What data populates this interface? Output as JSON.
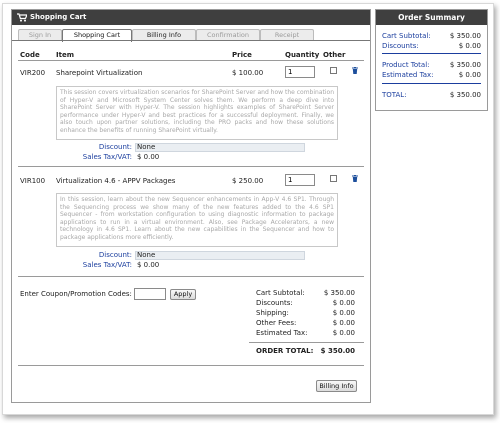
{
  "cart": {
    "title": "Shopping Cart",
    "tabs": [
      "Sign In",
      "Shopping Cart",
      "Billing Info",
      "Confirmation",
      "Receipt"
    ],
    "columns": {
      "code": "Code",
      "item": "Item",
      "price": "Price",
      "quantity": "Quantity",
      "other": "Other"
    },
    "items": [
      {
        "code": "VIR200",
        "name": "Sharepoint Virtualization",
        "price": "$ 100.00",
        "quantity": "1",
        "description": "This session covers virtualization scenarios for SharePoint Server and how the combination of Hyper-V and Microsoft System Center solves them. We perform a deep dive into SharePoint Server with Hyper-V. The session highlights examples of SharePoint Server performance under Hyper-V and best practices for a successful deployment. Finally, we also touch upon partner solutions, including the PRO packs and how these solutions enhance the benefits of running SharePoint virtually.",
        "discount_label": "Discount:",
        "discount_value": "None",
        "tax_label": "Sales Tax/VAT:",
        "tax_value": "$ 0.00"
      },
      {
        "code": "VIR100",
        "name": "Virtualization 4.6 - APPV Packages",
        "price": "$ 250.00",
        "quantity": "1",
        "description": "In this session, learn about the new Sequencer enhancements in App-V 4.6 SP1. Through the Sequencing process we show many of the new features added to the 4.6 SP1 Sequencer - from workstation configuration to using diagnostic information to package applications to run in a virtual environment. Also, see Package Accelerators, a new technology in 4.6 SP1. Learn about the new capabilities in the Sequencer and how to package applications more efficiently.",
        "discount_label": "Discount:",
        "discount_value": "None",
        "tax_label": "Sales Tax/VAT:",
        "tax_value": "$ 0.00"
      }
    ],
    "coupon": {
      "label": "Enter Coupon/Promotion Codes:",
      "value": "",
      "apply_label": "Apply"
    },
    "totals": [
      {
        "label": "Cart Subtotal:",
        "value": "$ 350.00"
      },
      {
        "label": "Discounts:",
        "value": "$ 0.00"
      },
      {
        "label": "Shipping:",
        "value": "$ 0.00"
      },
      {
        "label": "Other Fees:",
        "value": "$ 0.00"
      },
      {
        "label": "Estimated Tax:",
        "value": "$ 0.00"
      }
    ],
    "order_total": {
      "label": "ORDER TOTAL:",
      "value": "$ 350.00"
    },
    "billing_button": "Billing Info"
  },
  "summary": {
    "title": "Order Summary",
    "rows": [
      {
        "label": "Cart Subtotal:",
        "value": "$ 350.00"
      },
      {
        "label": "Discounts:",
        "value": "$ 0.00"
      },
      {
        "label": "Product Total:",
        "value": "$ 350.00"
      },
      {
        "label": "Estimated Tax:",
        "value": "$ 0.00"
      },
      {
        "label": "TOTAL:",
        "value": "$ 350.00"
      }
    ]
  },
  "colors": {
    "header_bg": "#3f3f3f",
    "link_blue": "#1b3e9e",
    "delete_icon": "#1d4f9c"
  },
  "icons": [
    "cart-icon",
    "trash-icon"
  ]
}
